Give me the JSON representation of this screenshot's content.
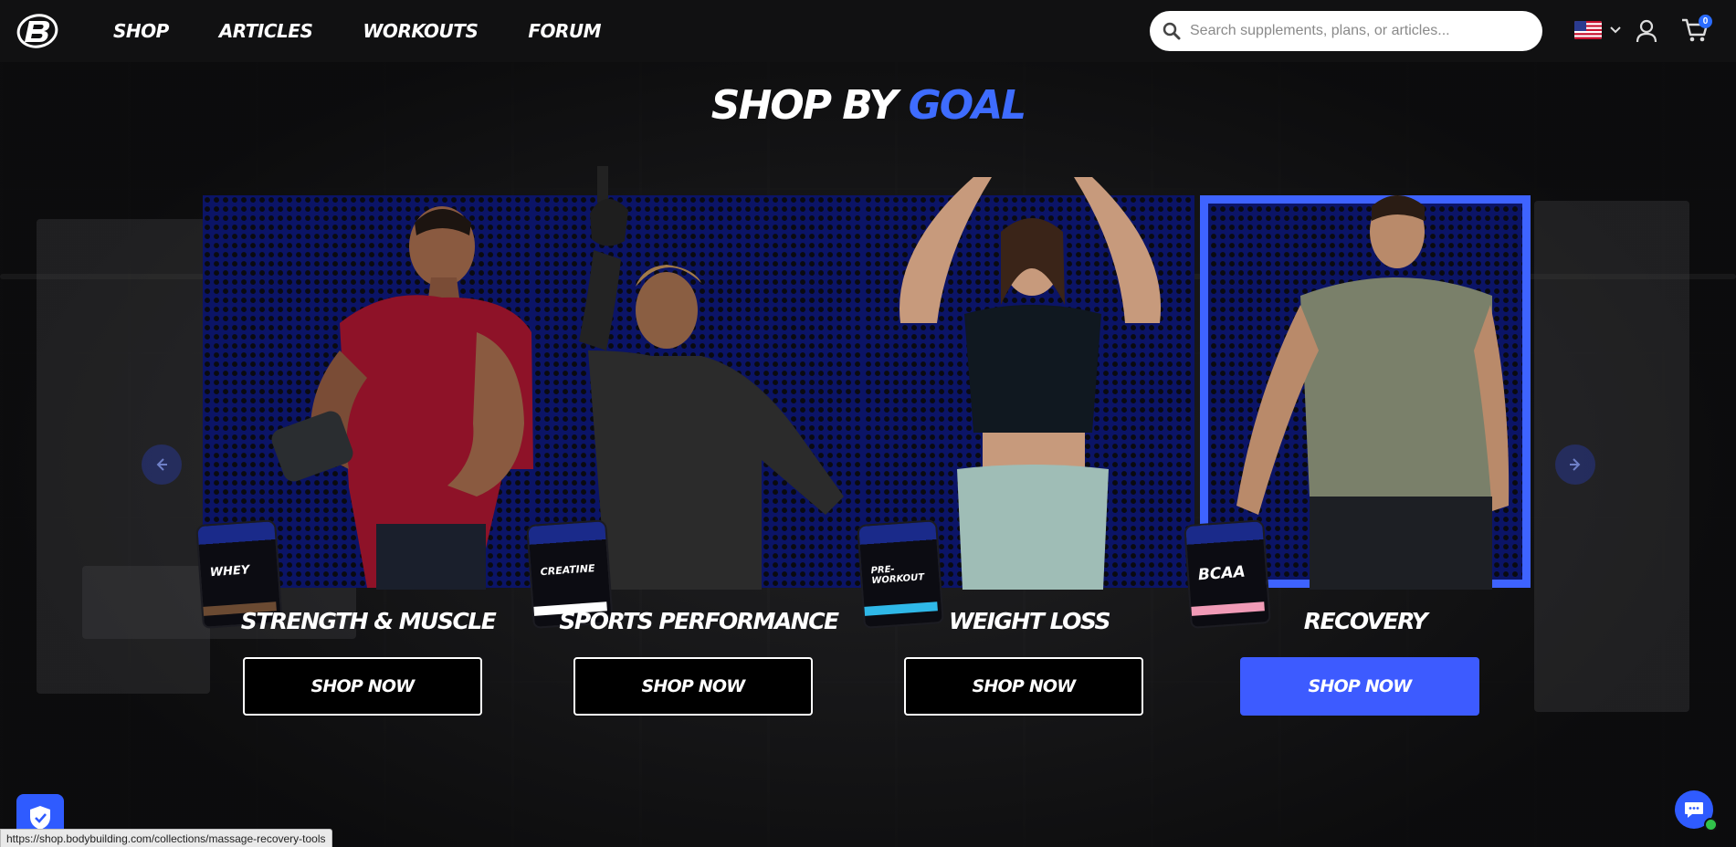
{
  "nav": {
    "links": [
      "SHOP",
      "ARTICLES",
      "WORKOUTS",
      "FORUM"
    ],
    "search_placeholder": "Search supplements, plans, or articles...",
    "cart_count": "0",
    "icons": [
      "logo-b-icon",
      "search-icon",
      "us-flag-icon",
      "chevron-down-icon",
      "user-icon",
      "cart-icon"
    ]
  },
  "heading": {
    "part1": "SHOP BY ",
    "part2": "GOAL"
  },
  "cards": [
    {
      "title": "STRENGTH & MUSCLE",
      "button": "SHOP NOW",
      "tub_label": "WHEY",
      "active": false
    },
    {
      "title": "SPORTS PERFORMANCE",
      "button": "SHOP NOW",
      "tub_label": "CREATINE",
      "active": false
    },
    {
      "title": "WEIGHT LOSS",
      "button": "SHOP NOW",
      "tub_label": "PRE-WORKOUT",
      "active": false
    },
    {
      "title": "RECOVERY",
      "button": "SHOP NOW",
      "tub_label": "BCAA",
      "active": true
    }
  ],
  "status_url": "https://shop.bodybuilding.com/collections/massage-recovery-tools",
  "colors": {
    "accent": "#3e6cff",
    "active_button": "#3d5bff",
    "nav_bg": "#111112"
  }
}
